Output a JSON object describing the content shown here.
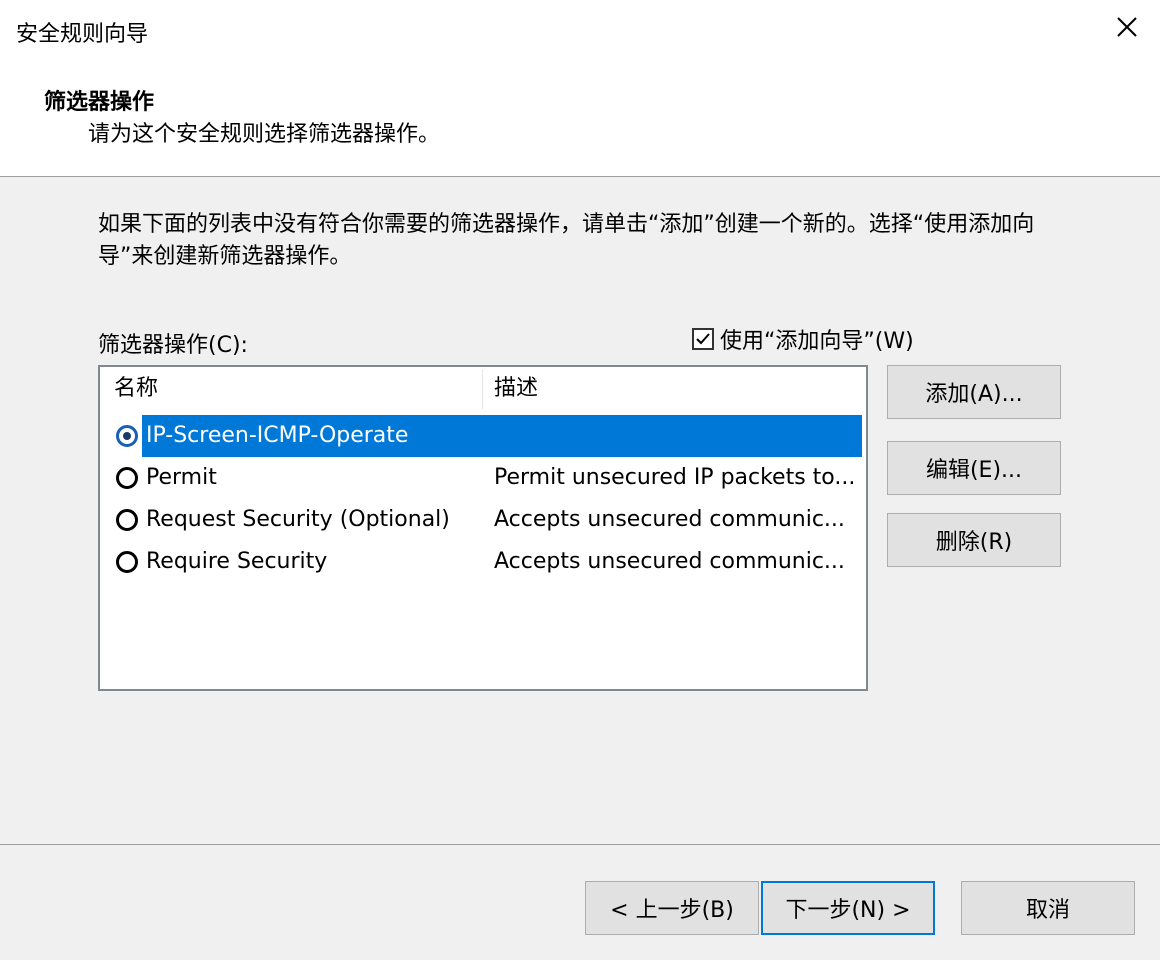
{
  "window": {
    "title": "安全规则向导",
    "close_icon": "close-icon"
  },
  "header": {
    "heading": "筛选器操作",
    "subheading": "请为这个安全规则选择筛选器操作。"
  },
  "intro_text": "如果下面的列表中没有符合你需要的筛选器操作，请单击“添加”创建一个新的。选择“使用添加向导”来创建新筛选器操作。",
  "filter_actions": {
    "label": "筛选器操作(C):",
    "use_wizard": {
      "label": "使用“添加向导”(W)",
      "checked": true
    },
    "columns": {
      "name": "名称",
      "description": "描述"
    },
    "rows": [
      {
        "name": "IP-Screen-ICMP-Operate",
        "description": "",
        "selected": true
      },
      {
        "name": "Permit",
        "description": "Permit unsecured IP packets to...",
        "selected": false
      },
      {
        "name": "Request Security (Optional)",
        "description": "Accepts unsecured communic...",
        "selected": false
      },
      {
        "name": "Require Security",
        "description": "Accepts unsecured communic...",
        "selected": false
      }
    ]
  },
  "side_buttons": {
    "add": "添加(A)...",
    "edit": "编辑(E)...",
    "delete": "删除(R)"
  },
  "footer": {
    "back": "< 上一步(B)",
    "next": "下一步(N) >",
    "cancel": "取消"
  },
  "colors": {
    "selection": "#0078d7",
    "background": "#f0f0f0"
  }
}
